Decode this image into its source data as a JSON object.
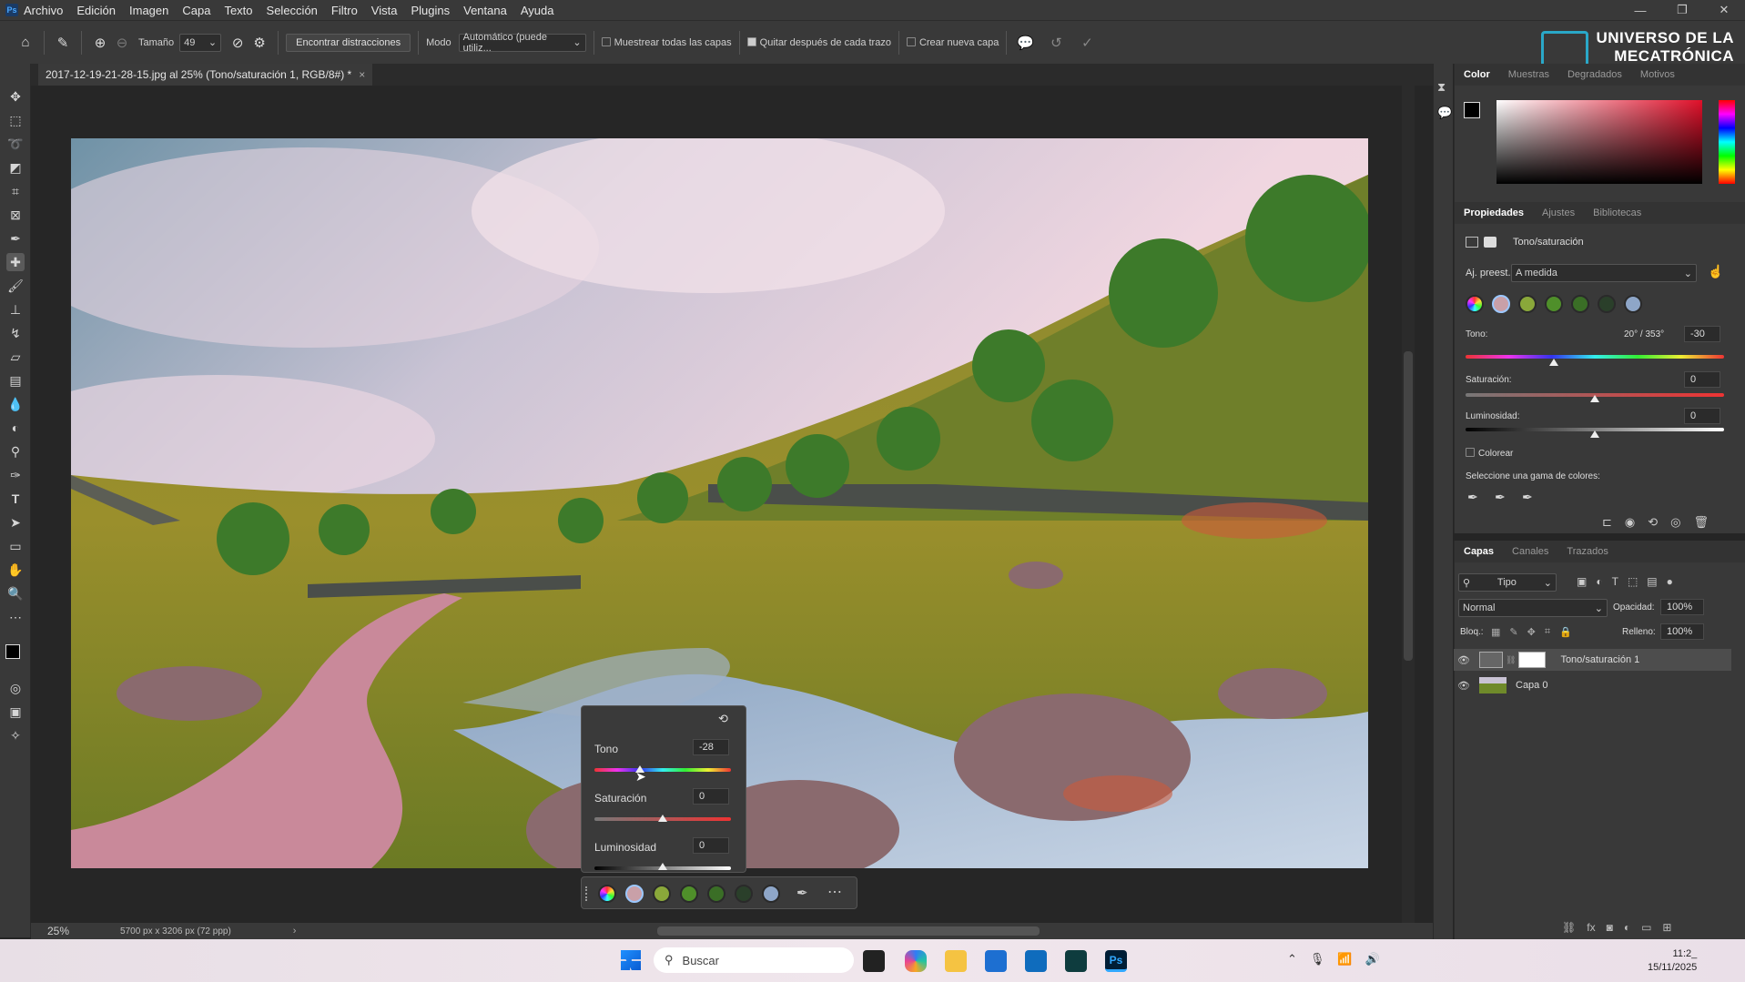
{
  "menubar": {
    "app_icon": "Ps",
    "items": [
      "Archivo",
      "Edición",
      "Imagen",
      "Capa",
      "Texto",
      "Selección",
      "Filtro",
      "Vista",
      "Plugins",
      "Ventana",
      "Ayuda"
    ]
  },
  "options": {
    "size_label": "Tamaño",
    "size_value": "49",
    "find_distractions": "Encontrar distracciones",
    "mode_label": "Modo",
    "mode_value": "Automático (puede utiliz...",
    "sample_all": "Muestrear todas las capas",
    "remove_after": "Quitar después de cada trazo",
    "create_layer": "Crear nueva capa",
    "sample_all_checked": false,
    "remove_after_checked": true,
    "create_layer_checked": false
  },
  "brand": {
    "line1": "UNIVERSO DE LA",
    "line2": "MECATRÓNICA"
  },
  "document": {
    "tab_title": "2017-12-19-21-28-15.jpg al 25% (Tono/saturación 1, RGB/8#) *",
    "zoom": "25%",
    "info": "5700 px x 3206 px (72 ppp)"
  },
  "float": {
    "tono_label": "Tono",
    "tono_value": "-28",
    "tono_level": 0.33,
    "sat_label": "Saturación",
    "sat_value": "0",
    "sat_level": 0.5,
    "lum_label": "Luminosidad",
    "lum_value": "0",
    "lum_level": 0.5
  },
  "color_panel": {
    "tabs": [
      "Color",
      "Muestras",
      "Degradados",
      "Motivos"
    ],
    "active": "Color"
  },
  "properties": {
    "tabs": [
      "Propiedades",
      "Ajustes",
      "Bibliotecas"
    ],
    "title": "Tono/saturación",
    "preset_label": "Aj. preest.:",
    "preset_value": "A medida",
    "tono_label": "Tono:",
    "tono_range": "20° / 353°",
    "tono_value": "-30",
    "tono_level": 0.34,
    "sat_label": "Saturación:",
    "sat_value": "0",
    "sat_level": 0.5,
    "lum_label": "Luminosidad:",
    "lum_value": "0",
    "lum_level": 0.5,
    "colorize_label": "Colorear",
    "range_label": "Seleccione una gama de colores:"
  },
  "layers": {
    "tabs": [
      "Capas",
      "Canales",
      "Trazados"
    ],
    "filter_value": "Tipo",
    "blend_mode": "Normal",
    "opacity_label": "Opacidad:",
    "opacity_value": "100%",
    "lock_label": "Bloq.:",
    "fill_label": "Relleno:",
    "fill_value": "100%",
    "items": [
      {
        "name": "Tono/saturación 1"
      },
      {
        "name": "Capa 0"
      }
    ]
  },
  "swatches": [
    "#c9a0a8",
    "#8aa83a",
    "#4f8f2a",
    "#3a6e26",
    "#2a3f2a",
    "#8ea6c8"
  ],
  "taskbar": {
    "search_placeholder": "Buscar",
    "time": "11:2_",
    "date": "15/11/2025"
  }
}
